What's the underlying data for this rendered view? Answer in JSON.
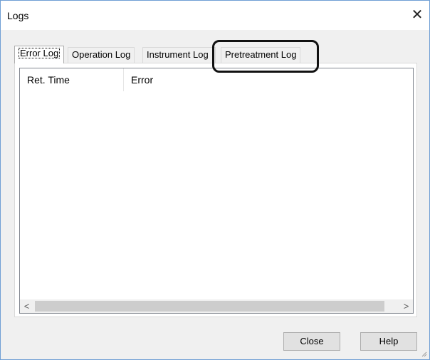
{
  "window": {
    "title": "Logs",
    "close_glyph": "✕"
  },
  "tabs": [
    {
      "label": "Error Log",
      "active": true
    },
    {
      "label": "Operation Log",
      "active": false
    },
    {
      "label": "Instrument Log",
      "active": false
    },
    {
      "label": "Pretreatment Log",
      "active": false
    }
  ],
  "list": {
    "columns": [
      "Ret. Time",
      "Error"
    ],
    "scroll_left": "<",
    "scroll_right": ">"
  },
  "buttons": {
    "close": "Close",
    "help": "Help"
  },
  "colors": {
    "highlight_outline": "#111111",
    "window_border": "#6f9fd4"
  }
}
